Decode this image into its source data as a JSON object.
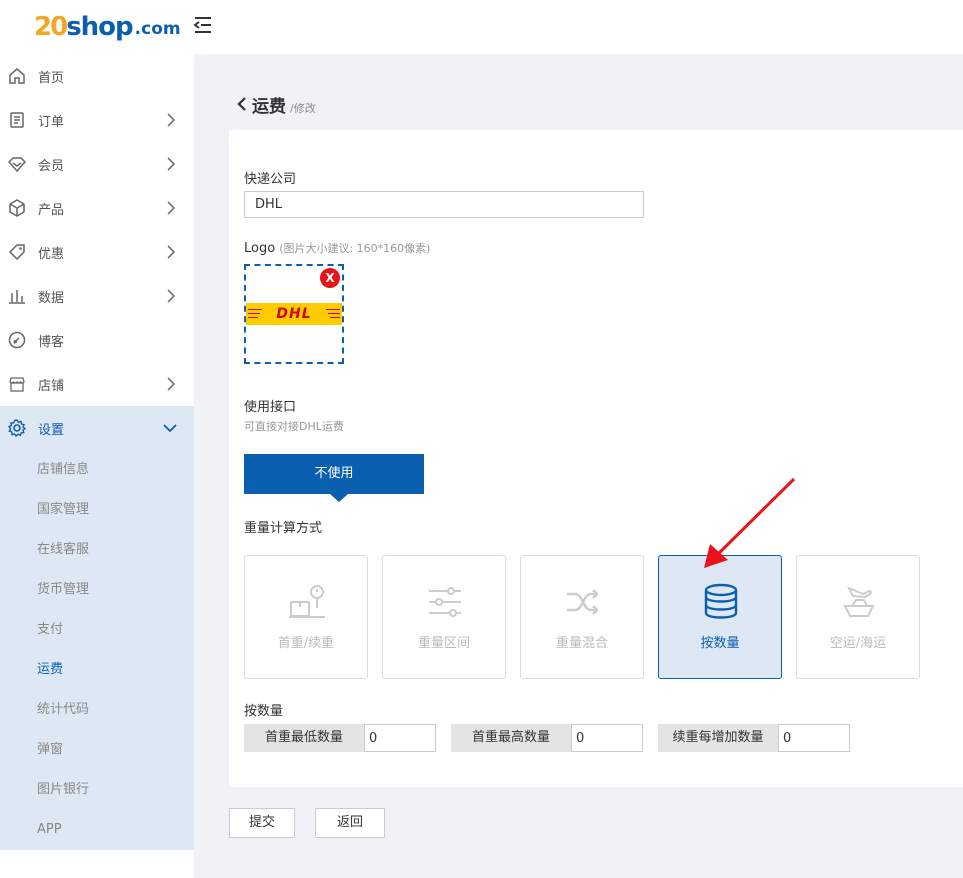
{
  "brand": {
    "num": "20",
    "name": "shop",
    "suffix": ".com"
  },
  "sidebar": {
    "items": [
      {
        "label": "首页",
        "icon": "home-icon",
        "has_children": false
      },
      {
        "label": "订单",
        "icon": "order-icon",
        "has_children": true
      },
      {
        "label": "会员",
        "icon": "member-icon",
        "has_children": true
      },
      {
        "label": "产品",
        "icon": "product-box-icon",
        "has_children": true
      },
      {
        "label": "优惠",
        "icon": "tag-icon",
        "has_children": true
      },
      {
        "label": "数据",
        "icon": "bar-chart-icon",
        "has_children": true
      },
      {
        "label": "博客",
        "icon": "blog-icon",
        "has_children": false
      },
      {
        "label": "店铺",
        "icon": "store-icon",
        "has_children": true
      },
      {
        "label": "设置",
        "icon": "gear-icon",
        "has_children": true,
        "expanded": true
      }
    ],
    "settings_sub": [
      "店铺信息",
      "国家管理",
      "在线客服",
      "货币管理",
      "支付",
      "运费",
      "统计代码",
      "弹窗",
      "图片银行",
      "APP"
    ],
    "current_sub": "运费"
  },
  "header": {
    "title": "运费",
    "subtitle": "/修改"
  },
  "form": {
    "company_label": "快递公司",
    "company_value": "DHL",
    "logo_label": "Logo",
    "logo_hint": "(图片大小建议: 160*160像素)",
    "logo_brand_text": "DHL",
    "logo_remove": "X",
    "api_label": "使用接口",
    "api_hint": "可直接对接DHL运费",
    "api_button": "不使用",
    "weight_method_label": "重量计算方式",
    "methods": [
      {
        "label": "首重/续重",
        "icon": "scale-clock-icon",
        "selected": false
      },
      {
        "label": "重量区间",
        "icon": "sliders-icon",
        "selected": false
      },
      {
        "label": "重量混合",
        "icon": "shuffle-icon",
        "selected": false
      },
      {
        "label": "按数量",
        "icon": "coin-stack-icon",
        "selected": true
      },
      {
        "label": "空运/海运",
        "icon": "plane-ship-icon",
        "selected": false
      }
    ],
    "qty_section_label": "按数量",
    "qty_fields": [
      {
        "label": "首重最低数量",
        "value": "0"
      },
      {
        "label": "首重最高数量",
        "value": "0"
      },
      {
        "label": "续重每增加数量",
        "value": "0"
      }
    ]
  },
  "actions": {
    "submit": "提交",
    "back": "返回"
  },
  "colors": {
    "accent": "#0b5fb0",
    "brand_orange": "#f5a623",
    "dhl_yellow": "#ffcc00",
    "dhl_red": "#d40511",
    "annotation_red": "#e8141a"
  }
}
